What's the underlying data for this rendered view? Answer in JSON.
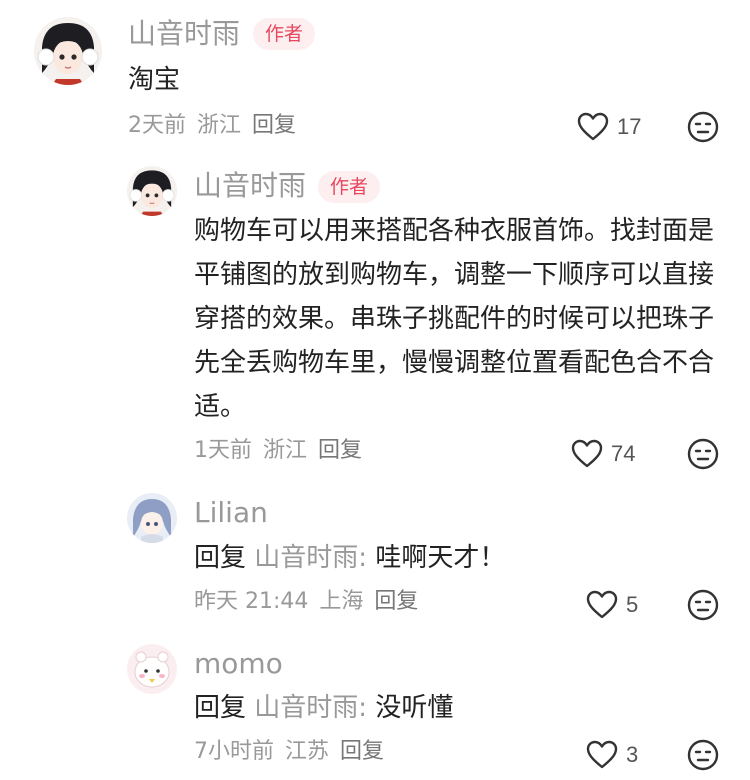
{
  "comments": [
    {
      "username": "山音时雨",
      "badge": "作者",
      "content": "淘宝",
      "time": "2天前",
      "location": "浙江",
      "reply_label": "回复",
      "likes": "17"
    },
    {
      "username": "山音时雨",
      "badge": "作者",
      "content": "购物车可以用来搭配各种衣服首饰。找封面是平铺图的放到购物车，调整一下顺序可以直接穿搭的效果。串珠子挑配件的时候可以把珠子先全丢购物车里，慢慢调整位置看配色合不合适。",
      "time": "1天前",
      "location": "浙江",
      "reply_label": "回复",
      "likes": "74"
    },
    {
      "username": "Lilian",
      "reply_prefix": "回复",
      "reply_target": "山音时雨:",
      "content": "哇啊天才！",
      "time": "昨天 21:44",
      "location": "上海",
      "reply_label": "回复",
      "likes": "5"
    },
    {
      "username": "momo",
      "reply_prefix": "回复",
      "reply_target": "山音时雨:",
      "content": "没听懂",
      "time": "7小时前",
      "location": "江苏",
      "reply_label": "回复",
      "likes": "3"
    }
  ]
}
